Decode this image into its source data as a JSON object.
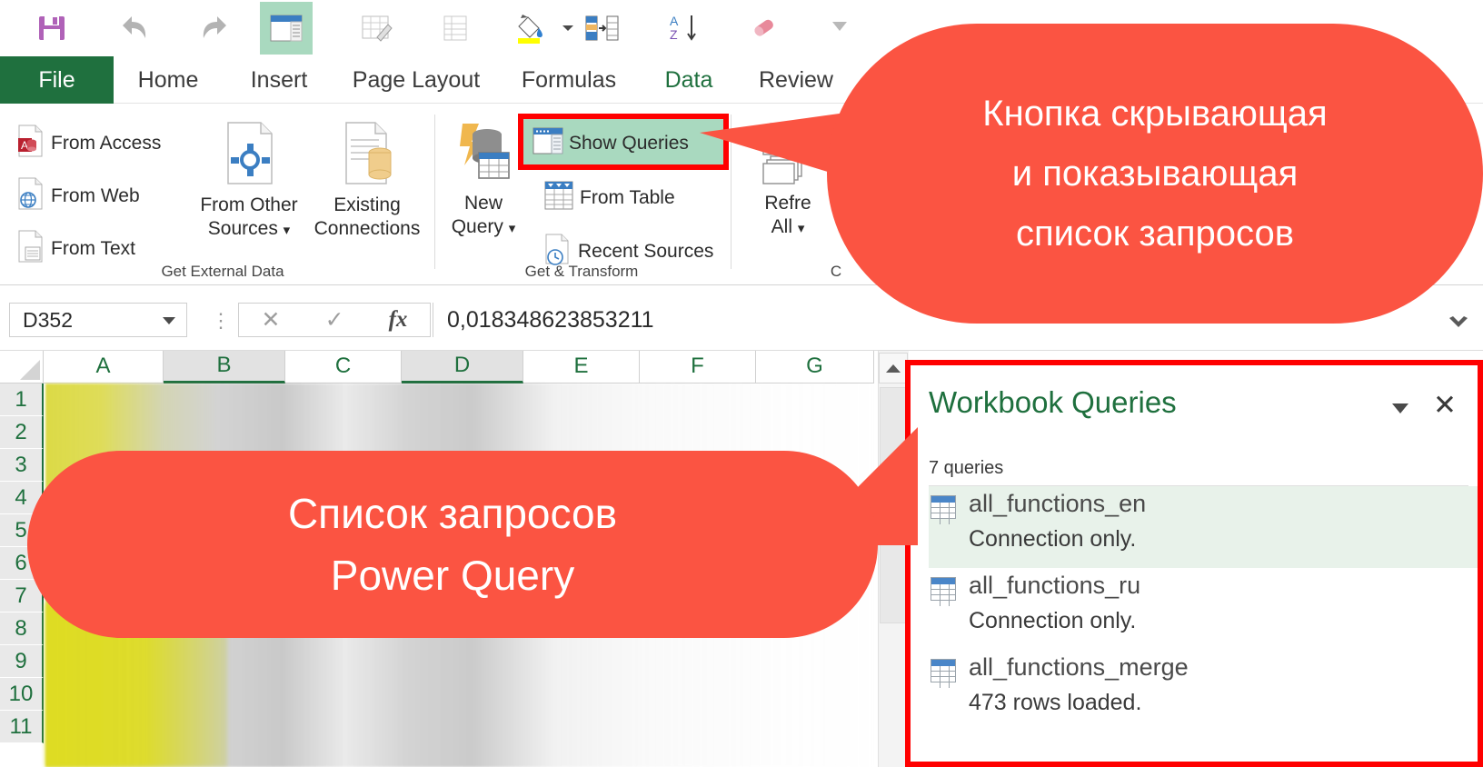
{
  "quick_access": {
    "buttons": [
      {
        "name": "save-icon",
        "label": "Save"
      },
      {
        "name": "undo-icon",
        "label": "Undo"
      },
      {
        "name": "redo-icon",
        "label": "Redo"
      },
      {
        "name": "freeze-panes-icon",
        "label": "Freeze Panes",
        "active": true
      },
      {
        "name": "edit-table-icon",
        "label": "Edit Table"
      },
      {
        "name": "list-icon",
        "label": "List"
      },
      {
        "name": "fill-color-icon",
        "label": "Fill Color"
      },
      {
        "name": "text-to-columns-icon",
        "label": "Text to Columns"
      },
      {
        "name": "sort-az-icon",
        "label": "Sort A to Z"
      },
      {
        "name": "clear-formatting-icon",
        "label": "Clear Formatting"
      },
      {
        "name": "customize-qat-icon",
        "label": "Customize Quick Access Toolbar"
      }
    ]
  },
  "ribbon": {
    "tabs": [
      {
        "label": "File",
        "active_file": true
      },
      {
        "label": "Home"
      },
      {
        "label": "Insert"
      },
      {
        "label": "Page Layout"
      },
      {
        "label": "Formulas"
      },
      {
        "label": "Data",
        "highlighted": true
      },
      {
        "label": "Review"
      }
    ],
    "groups": [
      {
        "label": "Get External Data",
        "small_buttons": [
          {
            "label": "From Access",
            "icon": "from-access-icon"
          },
          {
            "label": "From Web",
            "icon": "from-web-icon"
          },
          {
            "label": "From Text",
            "icon": "from-text-icon"
          }
        ],
        "big_buttons": [
          {
            "label_line1": "From Other",
            "label_line2": "Sources",
            "icon": "from-other-sources-icon",
            "has_dropdown": true
          },
          {
            "label_line1": "Existing",
            "label_line2": "Connections",
            "icon": "existing-connections-icon",
            "has_dropdown": false
          }
        ]
      },
      {
        "label": "Get & Transform",
        "big_buttons": [
          {
            "label_line1": "New",
            "label_line2": "Query",
            "icon": "new-query-icon",
            "has_dropdown": true
          }
        ],
        "small_buttons": [
          {
            "label": "Show Queries",
            "icon": "show-queries-icon",
            "highlighted": true,
            "toggled": true
          },
          {
            "label": "From Table",
            "icon": "from-table-icon"
          },
          {
            "label": "Recent Sources",
            "icon": "recent-sources-icon"
          }
        ]
      },
      {
        "label": "C",
        "big_buttons": [
          {
            "label_line1": "Refre",
            "label_line2": "All",
            "icon": "refresh-all-icon",
            "has_dropdown": true
          }
        ]
      }
    ]
  },
  "formula_bar": {
    "name_box_value": "D352",
    "cancel_icon": "cancel-icon",
    "confirm_icon": "confirm-icon",
    "fx_label": "fx",
    "formula_value": "0,018348623853211",
    "expand_icon": "chevron-down-icon"
  },
  "sheet": {
    "columns": [
      {
        "label": "A",
        "selected": false
      },
      {
        "label": "B",
        "selected": true
      },
      {
        "label": "C",
        "selected": false
      },
      {
        "label": "D",
        "selected": true
      },
      {
        "label": "E",
        "selected": false
      },
      {
        "label": "F",
        "selected": false
      },
      {
        "label": "G",
        "selected": false
      }
    ],
    "rows": [
      "1",
      "2",
      "3",
      "4",
      "5",
      "6",
      "7",
      "8",
      "9",
      "10",
      "11"
    ],
    "scroll_up_icon": "scroll-up-arrow-icon"
  },
  "workbook_queries": {
    "title": "Workbook Queries",
    "dropdown_icon": "chevron-down-icon",
    "close_icon": "close-icon",
    "count_label": "7 queries",
    "items": [
      {
        "name": "all_functions_en",
        "status": "Connection only.",
        "highlighted": true,
        "icon": "query-table-icon"
      },
      {
        "name": "all_functions_ru",
        "status": "Connection only.",
        "highlighted": false,
        "icon": "query-table-icon"
      },
      {
        "name": "all_functions_merge",
        "status": "473 rows loaded.",
        "highlighted": false,
        "icon": "query-table-icon"
      }
    ]
  },
  "callouts": [
    {
      "id": "callout-show-queries",
      "line1": "Кнопка скрывающая",
      "line2": "и показывающая",
      "line3": "список запросов",
      "color": "#fb5442"
    },
    {
      "id": "callout-query-list",
      "line1": "Список запросов",
      "line2": "Power Query",
      "color": "#fb5442"
    }
  ],
  "colors": {
    "accent_green": "#1f703e",
    "callout_red": "#fb5442",
    "highlight_red": "#ff0000",
    "toggle_green": "#a9d9bf"
  }
}
